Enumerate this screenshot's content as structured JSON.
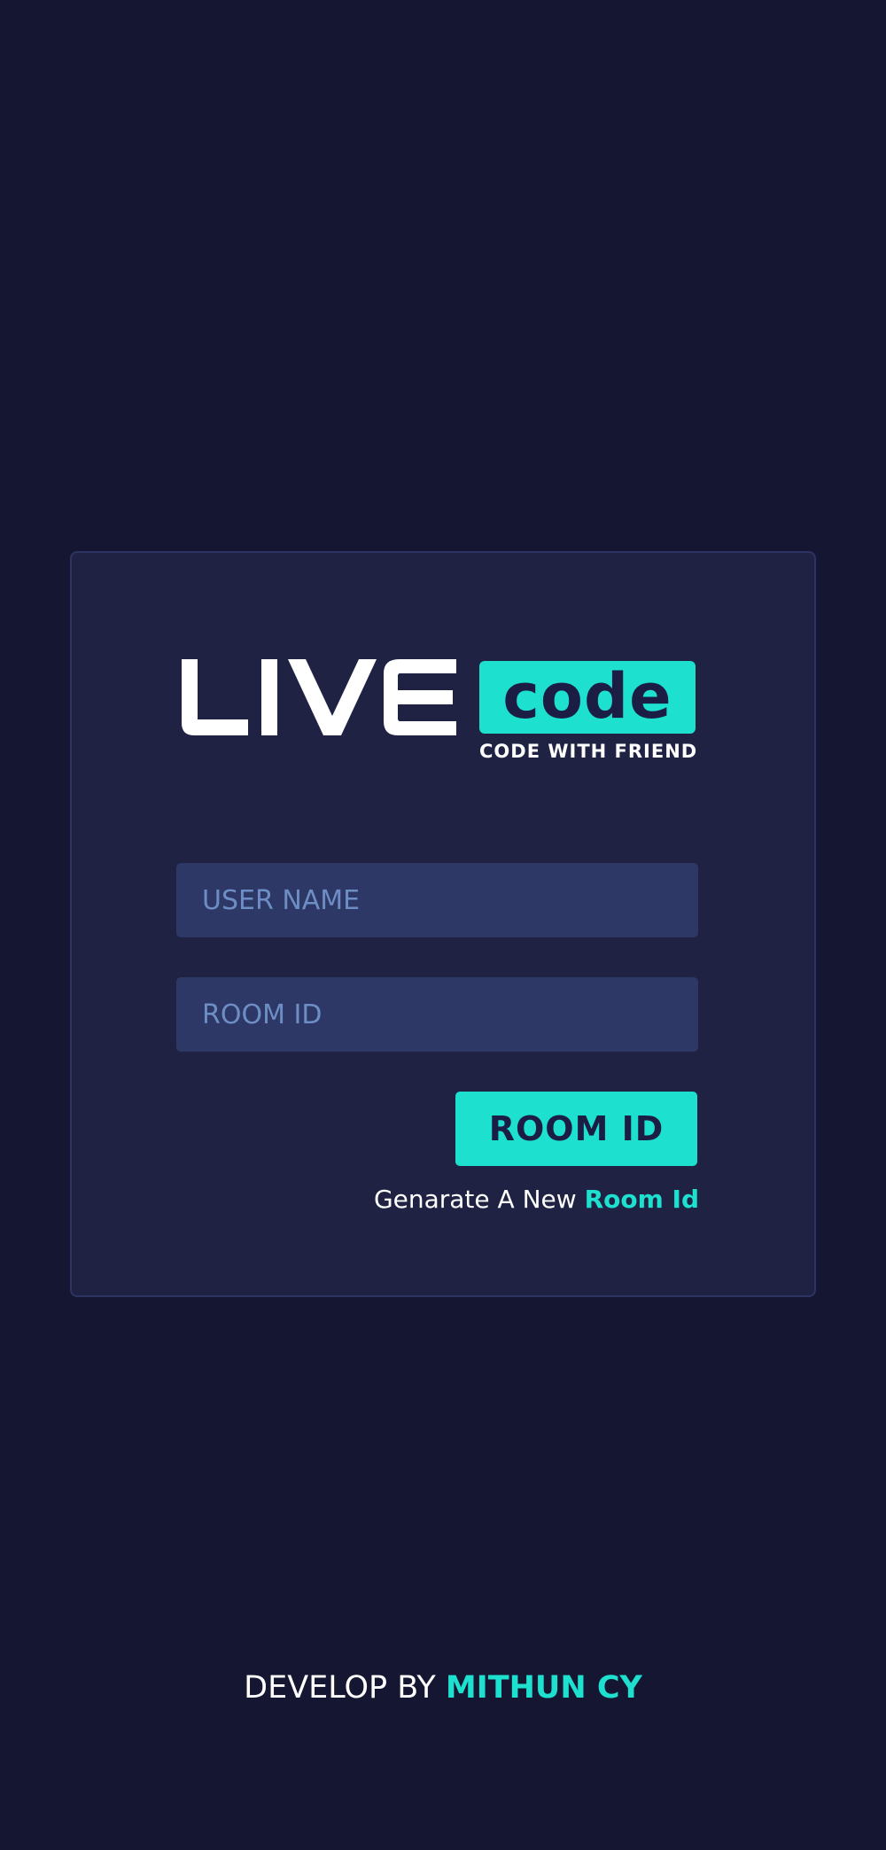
{
  "colors": {
    "background": "#151632",
    "card": "#1f2243",
    "card_border": "#2e3462",
    "input_background": "#2d3866",
    "placeholder": "#6d8ec4",
    "accent": "#1de0cf",
    "dark_text": "#1b1d45",
    "white": "#ffffff"
  },
  "logo": {
    "word": "LIVE",
    "badge": "code",
    "tagline": "CODE WITH FRIEND"
  },
  "form": {
    "username_placeholder": "USER NAME",
    "room_id_placeholder": "ROOM ID",
    "join_button_label": "ROOM ID",
    "generate_prefix": "Genarate A New",
    "generate_link": "Room Id"
  },
  "footer": {
    "prefix": "DEVELOP BY",
    "author": "MITHUN CY"
  }
}
